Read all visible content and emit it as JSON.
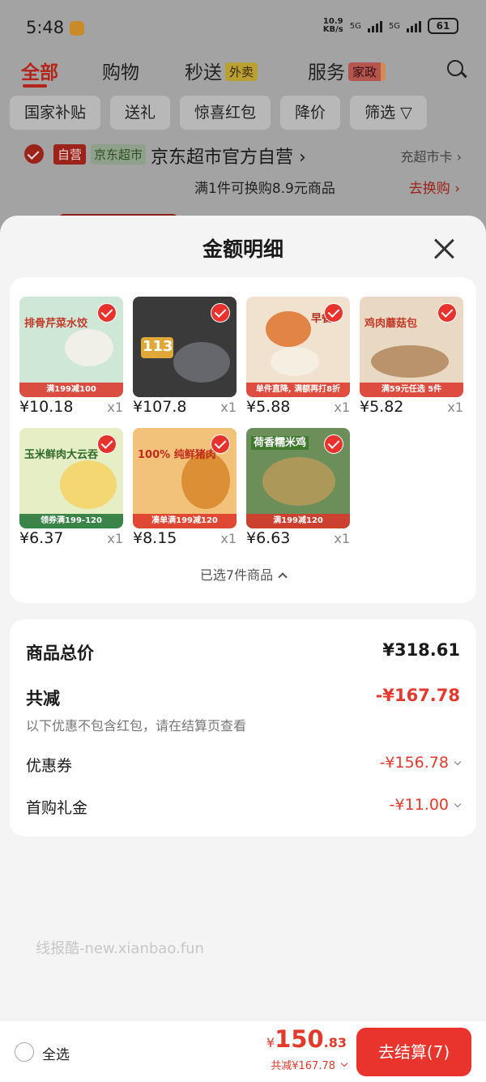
{
  "status_bar": {
    "time": "5:48",
    "net_speed": "10.9",
    "net_unit": "KB/s",
    "sig1": "5G",
    "sig2": "5G",
    "battery": "61"
  },
  "categories": [
    {
      "label": "全部",
      "active": true
    },
    {
      "label": "购物"
    },
    {
      "label": "秒送",
      "tag": "外卖"
    },
    {
      "label": "服务",
      "tag": "家政"
    }
  ],
  "filters": [
    "国家补贴",
    "送礼",
    "惊喜红包",
    "降价",
    "筛选"
  ],
  "shop": {
    "self_operated": "自营",
    "jd_tag": "京东超市",
    "name": "京东超市官方自营",
    "card": "充超市卡",
    "promo": "满1件可换购8.9元商品",
    "exchange": "去换购"
  },
  "sheet": {
    "title": "金额明细",
    "items": [
      {
        "price": "¥10.18",
        "qty": "x1",
        "thumb_text": "排骨芹菜水饺",
        "band": "满199减100",
        "color": "#cfe7d6"
      },
      {
        "price": "¥107.8",
        "qty": "x1",
        "thumb_text": "113",
        "band": "",
        "color": "#3a3a3a"
      },
      {
        "price": "¥5.88",
        "qty": "x1",
        "thumb_text": "早餐",
        "band": "单件直降, 满额再打8折",
        "color": "#f1e2cf"
      },
      {
        "price": "¥5.82",
        "qty": "x1",
        "thumb_text": "鸡肉蘑菇包",
        "band": "满59元任选 5件",
        "color": "#e9d9c2"
      },
      {
        "price": "¥6.37",
        "qty": "x1",
        "thumb_text": "玉米鲜肉大云吞",
        "band": "领券满199-120",
        "color": "#e5eec4"
      },
      {
        "price": "¥8.15",
        "qty": "x1",
        "thumb_text": "100% 纯鲜猪肉",
        "band": "凑单满199减120",
        "color": "#f3c27a"
      },
      {
        "price": "¥6.63",
        "qty": "x1",
        "thumb_text": "荷香糯米鸡",
        "band": "满199减120",
        "color": "#6c8f5a"
      }
    ],
    "selected_summary": "已选7件商品"
  },
  "totals": {
    "subtotal_label": "商品总价",
    "subtotal": "¥318.61",
    "reduction_label": "共减",
    "reduction": "-¥167.78",
    "note": "以下优惠不包含红包，请在结算页查看",
    "coupon_label": "优惠券",
    "coupon": "-¥156.78",
    "first_gift_label": "首购礼金",
    "first_gift": "-¥11.00"
  },
  "watermark": "线报酷-new.xianbao.fun",
  "bottom_bar": {
    "select_all": "全选",
    "yen": "¥",
    "pay_int": "150",
    "pay_dec": ".83",
    "saved": "共减¥167.78",
    "checkout": "去结算(7)"
  },
  "colors": {
    "accent": "#e8342c",
    "discount": "#e33a2e"
  }
}
